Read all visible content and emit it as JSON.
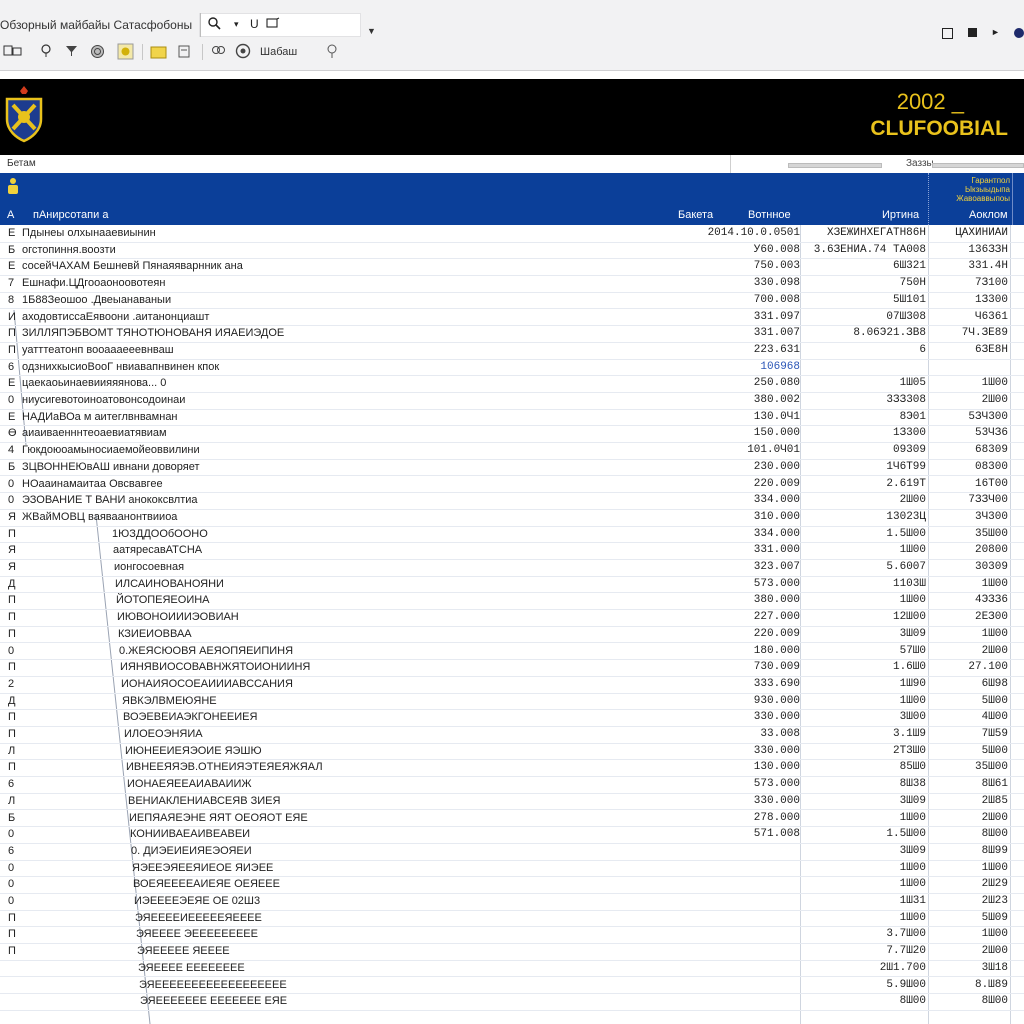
{
  "toolbar": {
    "document_title": "Обзорный майбайы Сатасфобоны",
    "search_icon": "search-icon",
    "tools_label": "Шабаш"
  },
  "banner": {
    "year": "2002 _",
    "brand": "CLUFOOBIAL",
    "crest_icon": "club-crest-icon",
    "accent_color": "#e9c21c",
    "background_color": "#000000"
  },
  "subbar": {
    "label": "Бетам",
    "page_label": "Заззы"
  },
  "table": {
    "header_color": "#0b3f99",
    "corner_text": "Гарантпол Ыкзыыдыпа Жавоаввыпоы",
    "columns": [
      "А",
      "пАнирсотапи а",
      "Бакета",
      "Вотнное",
      "Иртина",
      "Аоклом"
    ],
    "rows": [
      {
        "mark": "Е",
        "name": "Пдынеы олхынааевиынин",
        "v1": "2014.10.0.0501",
        "v2": "ХЗЕЖИНХЕГАТН86Н",
        "v3": "ЦАХИНИАИ"
      },
      {
        "mark": "Б",
        "name": "огстопиння.воозти",
        "v1": "У60.008",
        "v2": "3.6ЗЕНИА.74 ТА008",
        "v3": "136ЗЗН"
      },
      {
        "mark": "Е",
        "name": "сосейЧАХАМ Бешневй Пянаяяварнник ана",
        "v1": "750.003",
        "v2": "6Ш321",
        "v3": "331.4Н"
      },
      {
        "mark": "7",
        "name": "Ешнафи.ЦДгооаоноовотеян",
        "v1": "330.098",
        "v2": "750Н",
        "v3": "7З100"
      },
      {
        "mark": "8",
        "name": "1Б88Зеошоо .Двеыанаваныи",
        "v1": "700.008",
        "v2": "5Ш101",
        "v3": "1З300"
      },
      {
        "mark": "И",
        "name": "аходовтиссаЕявоони .аитанонциашт",
        "v1": "331.097",
        "v2": "07Ш308",
        "v3": "Ч6361"
      },
      {
        "mark": "П",
        "name": "ЗИЛЛЯПЭБВОМТ ТЯНОТЮНОВАНЯ ИЯАЕИЭДОЕ",
        "v1": "331.007",
        "v2": "8.06Э21.ЗВ8",
        "v3": "7Ч.ЗЕ89"
      },
      {
        "mark": "П",
        "name": "уатттеатонп вооаааееевнваш",
        "v1": "223.631",
        "v2": "6",
        "v3": "6ЗЕ8Н"
      },
      {
        "mark": "6",
        "name": "одзнихкысиоВооГ нвиавапнвинен кпок",
        "v1": "106968",
        "v1_blue": true,
        "v2": "",
        "v3": ""
      },
      {
        "mark": "Е",
        "name": "цаекаоьинаевиияяянова... 0",
        "v1": "250.080",
        "v2": "1Ш05",
        "v3": "1Ш00"
      },
      {
        "mark": "0",
        "name": "ниусигевотоиноатовонсодоинаи",
        "v1": "380.002",
        "v2": "3ЗЗ308",
        "v3": "2Ш00"
      },
      {
        "mark": "Е",
        "name": "НАДИаВОа м аитеглвнвамнан",
        "v1": "130.0Ч1",
        "v2": "8Э01",
        "v3": "5ЗЧ300"
      },
      {
        "mark": "Ө",
        "name": "аиаиваенннтеоаевиатявиам",
        "v1": "150.000",
        "v2": "1З300",
        "v3": "53ЧЗ6"
      },
      {
        "mark": "4",
        "name": "Гюкдоюоамыносиаемойеоввилини",
        "v1": "101.0Ч01",
        "v2": "09309",
        "v3": "68309"
      },
      {
        "mark": "Б",
        "name": "ЗЦВОННЕЮвАШ ивнани доворяет",
        "v1": "230.000",
        "v2": "1Ч6Т99",
        "v3": "08300"
      },
      {
        "mark": "0",
        "name": "НОааинамаитаа Овсвавгее",
        "v1": "220.009",
        "v2": "2.619Т",
        "v3": "16Т00"
      },
      {
        "mark": "0",
        "name": "ЭЗОВАНИЕ Т ВАНИ анококсвлтиа",
        "v1": "334.000",
        "v2": "2Ш00",
        "v3": "7ЗЗЧ00"
      },
      {
        "mark": "Я",
        "name": "ЖВайМОВЦ ваяваанонтвииоа",
        "v1": "310.000",
        "v2": "13023Ц",
        "v3": "3Ч300"
      },
      {
        "mark": "П",
        "name": "1ЮЗДДООбООНО",
        "v1": "334.000",
        "v2": "1.5Ш00",
        "v3": "35Ш00"
      },
      {
        "mark": "Я",
        "name": "аатяресавАТСНА",
        "v1": "331.000",
        "v2": "1Ш00",
        "v3": "20800"
      },
      {
        "mark": "Я",
        "name": "ионгосоевная",
        "v1": "323.007",
        "v2": "5.6007",
        "v3": "30309"
      },
      {
        "mark": "Д",
        "name": "ИЛСАИНОВАНОЯНИ",
        "v1": "573.000",
        "v2": "1103Ш",
        "v3": "1Ш00"
      },
      {
        "mark": "П",
        "name": "ЙОТОПЕЯЕОИНА",
        "v1": "380.000",
        "v2": "1Ш00",
        "v3": "4ЭЗЗ6"
      },
      {
        "mark": "П",
        "name": "ИЮВОНОИИИЭОВИАН",
        "v1": "227.000",
        "v2": "12Ш00",
        "v3": "2ЕЗ00"
      },
      {
        "mark": "П",
        "name": "КЗИЕИОВВАА",
        "v1": "220.009",
        "v2": "3Ш09",
        "v3": "1Ш00"
      },
      {
        "mark": "0",
        "name": "0.ЖЕЯСЮОВЯ АЕЯОПЯЕИПИНЯ",
        "v1": "180.000",
        "v2": "57Ш0",
        "v3": "2Ш00"
      },
      {
        "mark": "П",
        "name": "ИЯНЯВИОСОВАВНЖЯТОИОНИИНЯ",
        "v1": "730.009",
        "v2": "1.6Ш0",
        "v3": "27.100"
      },
      {
        "mark": "2",
        "name": "ИОНАИЯОСОЕАИИИАВССАНИЯ",
        "v1": "333.690",
        "v2": "1Ш90",
        "v3": "6Ш98"
      },
      {
        "mark": "Д",
        "name": "ЯВКЭЛВМЕЮЯНЕ",
        "v1": "930.000",
        "v2": "1Ш00",
        "v3": "5Ш00"
      },
      {
        "mark": "П",
        "name": "ВОЭЕВЕИАЭКГОНЕЕИЕЯ",
        "v1": "330.000",
        "v2": "3Ш00",
        "v3": "4Ш00"
      },
      {
        "mark": "П",
        "name": "ИЛОЕОЭНЯИА",
        "v1": "33.008",
        "v2": "3.1Ш9",
        "v3": "7Ш59"
      },
      {
        "mark": "Л",
        "name": "ИЮНЕЕИЕЯЭОИЕ ЯЭШЮ",
        "v1": "330.000",
        "v2": "2Т3Ш0",
        "v3": "5Ш00"
      },
      {
        "mark": "П",
        "name": "ИВНЕЕЯЯЭВ.ОТНЕИЯЭТЕЯЕЯЖЯАЛ",
        "v1": "130.000",
        "v2": "85Ш0",
        "v3": "35Ш00"
      },
      {
        "mark": "6",
        "name": "ИОНАЕЯЕЕАИАВАИИЖ",
        "v1": "573.000",
        "v2": "8Ш38",
        "v3": "8Ш61"
      },
      {
        "mark": "Л",
        "name": "ВЕНИАКЛЕНИАВСЕЯВ ЗИЕЯ",
        "v1": "330.000",
        "v2": "3Ш09",
        "v3": "2Ш85"
      },
      {
        "mark": "Б",
        "name": "ИЕПЯАЯЕЭНЕ ЯЯТ ОЕОЯОТ ЕЯЕ",
        "v1": "278.000",
        "v2": "1Ш00",
        "v3": "2Ш00"
      },
      {
        "mark": "0",
        "name": "КОНИИВАЕАИВЕАВЕИ",
        "v1": "571.008",
        "v2": "1.5Ш00",
        "v3": "8Ш00"
      },
      {
        "mark": "6",
        "name": "0. ДИЭЕИЕИЯЕЭОЯЕИ",
        "v1": "",
        "v2": "3Ш09",
        "v3": "8Ш99"
      },
      {
        "mark": "0",
        "name": "ЯЭЕЕЭЯЕЕЯИЕОЕ ЯИЭЕЕ",
        "v1": "",
        "v2": "1Ш00",
        "v3": "1Ш00"
      },
      {
        "mark": "0",
        "name": "ВОЕЯЕЕЕЕАИЕЯЕ ОЕЯЕЕЕ",
        "v1": "",
        "v2": "1Ш00",
        "v3": "2Ш29"
      },
      {
        "mark": "0",
        "name": "ИЭЕЕЕЕЭЕЯЕ ОЕ 02Ш3",
        "v1": "",
        "v2": "1Ш31",
        "v3": "2Ш23"
      },
      {
        "mark": "П",
        "name": "ЭЯЕЕЕЕИЕЕЕЕЕЯЕЕЕЕ",
        "v1": "",
        "v2": "1Ш00",
        "v3": "5Ш09"
      },
      {
        "mark": "П",
        "name": "ЭЯЕЕЕЕ ЭЕЕЕЕЕЕЕЕЕ",
        "v1": "",
        "v2": "3.7Ш00",
        "v3": "1Ш00"
      },
      {
        "mark": "П",
        "name": "ЭЯЕЕЕЕЕ ЯЕЕЕЕ",
        "v1": "",
        "v2": "7.7Ш20",
        "v3": "2Ш00"
      },
      {
        "mark": "",
        "name": "ЭЯЕЕЕЕ ЕЕЕЕЕЕЕЕ",
        "v1": "",
        "v2": "2Ш1.700",
        "v3": "3Ш18"
      },
      {
        "mark": "",
        "name": "ЭЯЕЕЕЕЕЕЕЕЕЕЕЕЕЕЕЕЕЕ",
        "v1": "",
        "v2": "5.9Ш00",
        "v3": "8.Ш89"
      },
      {
        "mark": "",
        "name": "ЭЯЕЕЕЕЕЕЕ ЕЕЕЕЕЕЕ ЕЯЕ",
        "v1": "",
        "v2": "8Ш00",
        "v3": "8Ш00"
      }
    ]
  }
}
